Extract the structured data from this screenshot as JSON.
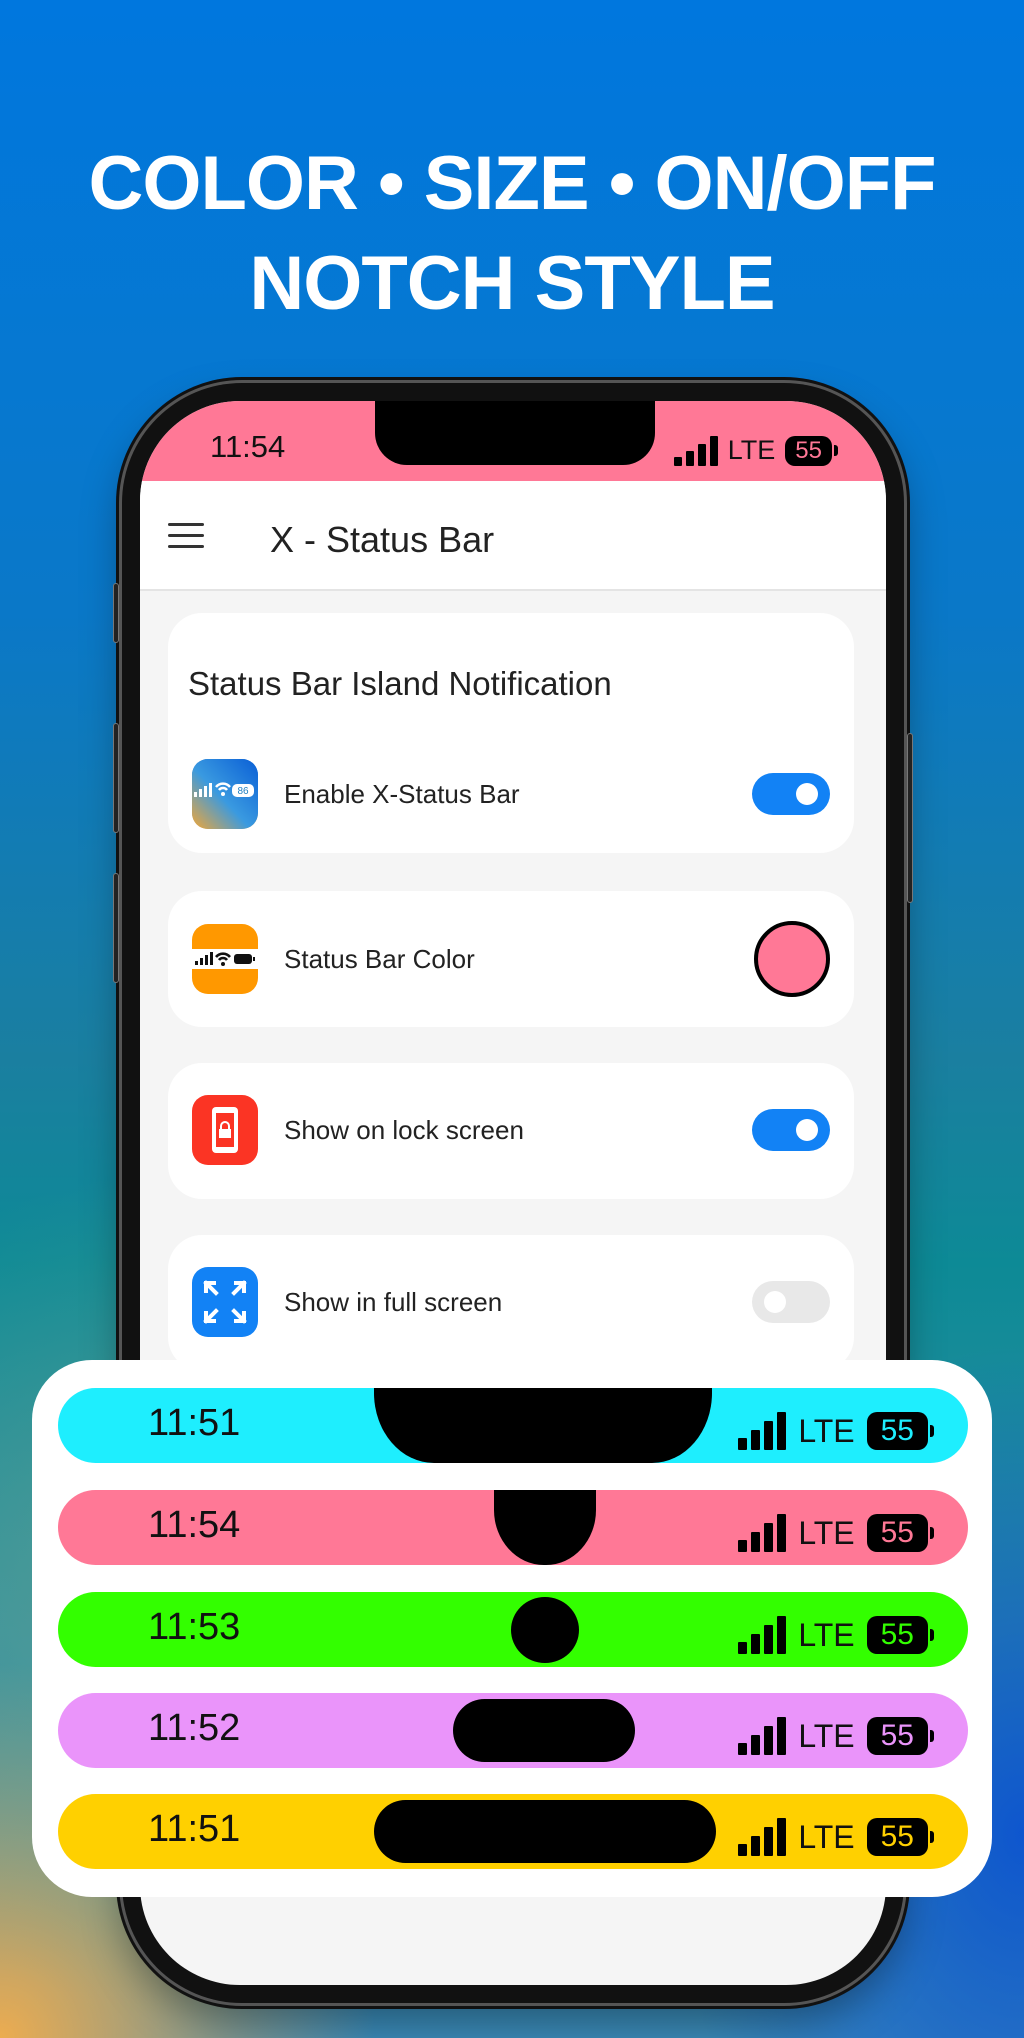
{
  "headline": {
    "line1": "COLOR • SIZE  • ON/OFF",
    "line2": "NOTCH STYLE"
  },
  "phone": {
    "status_bar": {
      "time": "11:54",
      "network": "LTE",
      "battery": "55",
      "color": "#ff7896"
    },
    "app_bar": {
      "menu_icon": "hamburger-menu-icon",
      "title": "X - Status Bar"
    },
    "section": {
      "title": "Status Bar Island Notification"
    },
    "settings": [
      {
        "label": "Enable X-Status Bar",
        "icon": "status-bar-app-icon",
        "control": "toggle",
        "value": true
      },
      {
        "label": "Status Bar Color",
        "icon": "status-bar-color-icon",
        "control": "color-swatch",
        "value": "#ff7896"
      },
      {
        "label": "Show on lock screen",
        "icon": "lock-screen-icon",
        "control": "toggle",
        "value": true
      },
      {
        "label": "Show in full screen",
        "icon": "fullscreen-expand-icon",
        "control": "toggle",
        "value": false
      }
    ]
  },
  "previews": [
    {
      "time": "11:51",
      "color": "#1eeefe",
      "notch_style": "wide-notch",
      "network": "LTE",
      "battery": "55"
    },
    {
      "time": "11:54",
      "color": "#ff7896",
      "notch_style": "teardrop",
      "network": "LTE",
      "battery": "55"
    },
    {
      "time": "11:53",
      "color": "#33ff00",
      "notch_style": "punch-hole",
      "network": "LTE",
      "battery": "55"
    },
    {
      "time": "11:52",
      "color": "#ea94fa",
      "notch_style": "small-island",
      "network": "LTE",
      "battery": "55"
    },
    {
      "time": "11:51",
      "color": "#ffd000",
      "notch_style": "large-island",
      "network": "LTE",
      "battery": "55"
    }
  ]
}
